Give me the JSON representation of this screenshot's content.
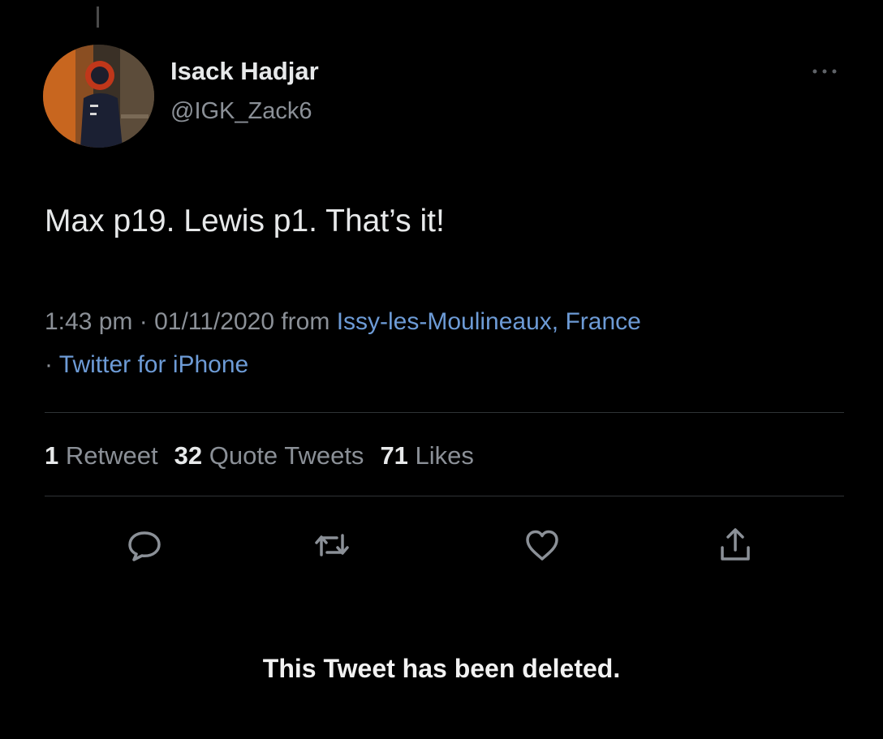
{
  "author": {
    "display_name": "Isack Hadjar",
    "handle": "@IGK_Zack6"
  },
  "tweet": {
    "text": "Max p19. Lewis p1. That’s it!",
    "time": "1:43 pm",
    "date": "01/11/2020",
    "from_label": "from",
    "location": "Issy-les-Moulineaux, France",
    "source": "Twitter for iPhone"
  },
  "stats": {
    "retweets_count": "1",
    "retweets_label": "Retweet",
    "quotes_count": "32",
    "quotes_label": "Quote Tweets",
    "likes_count": "71",
    "likes_label": "Likes"
  },
  "actions": [
    {
      "name": "reply",
      "icon": "reply-icon"
    },
    {
      "name": "retweet",
      "icon": "retweet-icon"
    },
    {
      "name": "like",
      "icon": "heart-icon"
    },
    {
      "name": "share",
      "icon": "share-icon"
    }
  ],
  "notice": "This Tweet has been deleted.",
  "colors": {
    "background": "#000000",
    "text": "#e7e9ea",
    "muted": "#8b9097",
    "link": "#6d9bd6",
    "divider": "#2f3336"
  }
}
